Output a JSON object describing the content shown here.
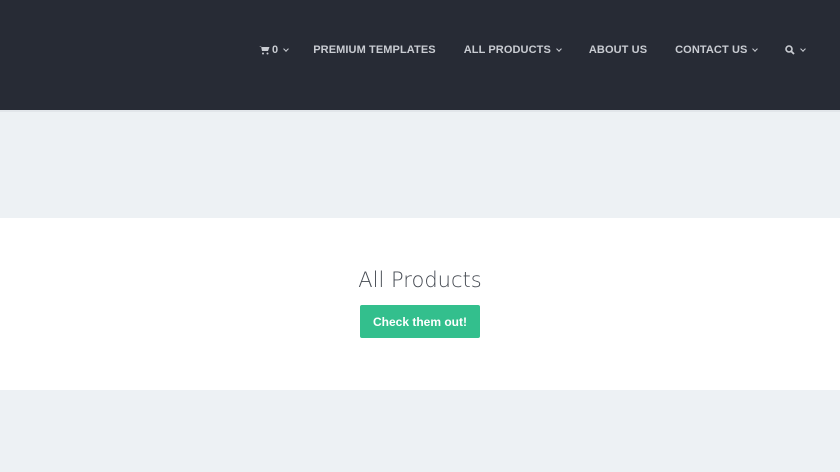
{
  "nav": {
    "cart_count": "0",
    "items": [
      "PREMIUM TEMPLATES",
      "ALL PRODUCTS",
      "ABOUT US",
      "CONTACT US"
    ]
  },
  "hero": {
    "title": "All Products",
    "button": "Check them out!"
  }
}
